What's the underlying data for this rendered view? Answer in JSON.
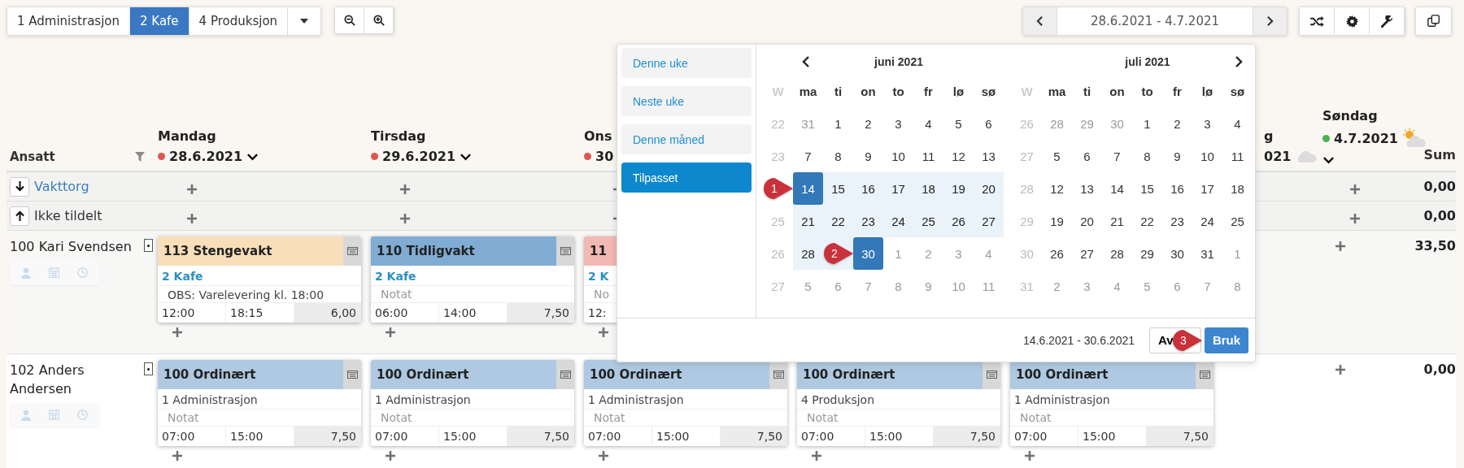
{
  "unit_tabs": [
    {
      "label": "1 Administrasjon",
      "selected": false
    },
    {
      "label": "2 Kafe",
      "selected": true
    },
    {
      "label": "4 Produksjon",
      "selected": false
    }
  ],
  "date_range": "28.6.2021 - 4.7.2021",
  "grid": {
    "employee_header": "Ansatt",
    "sum_header": "Sum",
    "days": [
      {
        "name": "Mandag",
        "date": "28.6.2021",
        "color": "#e05552",
        "chevron": true
      },
      {
        "name": "Tirsdag",
        "date": "29.6.2021",
        "color": "#e05552",
        "chevron": true
      },
      {
        "name": "Ons",
        "date": "30",
        "color": "#e05552",
        "chevron": false
      }
    ],
    "days_right": [
      {
        "name": "g",
        "date": "021",
        "weather": {
          "kind": "cloudy"
        },
        "chevron": false
      },
      {
        "name": "Søndag",
        "date": "4.7.2021",
        "color": "#4cb050",
        "weather": {
          "kind": "partly-sunny"
        },
        "chevron": true
      }
    ],
    "rows": [
      {
        "kind": "pool",
        "label": "Vakttorg",
        "arrow": {
          "kind": "down"
        },
        "link": true,
        "sum": "0,00",
        "cells": [
          {
            "add": true
          },
          {
            "add": true
          },
          {
            "add": true
          },
          null,
          null,
          null,
          {
            "add": true
          }
        ]
      },
      {
        "kind": "pool",
        "label": "Ikke tildelt",
        "arrow": {
          "kind": "up"
        },
        "link": false,
        "sum": "0,00",
        "cells": [
          {
            "add": true
          },
          {
            "add": true
          },
          {
            "add": true
          },
          null,
          null,
          null,
          {
            "add": true
          }
        ]
      },
      {
        "kind": "employee",
        "name": "100 Kari Svendsen",
        "sum": "33,50",
        "cells": [
          {
            "add": true,
            "shift": {
              "title": "113 Stengevakt",
              "color": "#f8dfb9",
              "unit": "2 Kafe",
              "unit_link": true,
              "note": "OBS: Varelevering kl. 18:00",
              "start": "12:00",
              "end": "18:15",
              "hours": "6,00"
            }
          },
          {
            "add": true,
            "shift": {
              "title": "110 Tidligvakt",
              "color": "#80acd3",
              "unit": "2 Kafe",
              "unit_link": true,
              "note_placeholder": "Notat",
              "start": "06:00",
              "end": "14:00",
              "hours": "7,50"
            }
          },
          {
            "add": true,
            "shift": {
              "title": "11",
              "color": "#f2b8b4",
              "unit": "2 K",
              "unit_link": true,
              "note_placeholder": "No",
              "start": "12:"
            }
          },
          null,
          null,
          null,
          {
            "add": true
          }
        ]
      },
      {
        "kind": "employee",
        "name": "102 Anders Andersen",
        "sum": "0,00",
        "cells": [
          {
            "add": true,
            "shift": {
              "title": "100 Ordinært",
              "color": "#afc9e2",
              "unit": "1 Administrasjon",
              "unit_link": false,
              "note_placeholder": "Notat",
              "start": "07:00",
              "end": "15:00",
              "hours": "7,50"
            }
          },
          {
            "add": true,
            "shift": {
              "title": "100 Ordinært",
              "color": "#afc9e2",
              "unit": "1 Administrasjon",
              "unit_link": false,
              "note_placeholder": "Notat",
              "start": "07:00",
              "end": "15:00",
              "hours": "7,50"
            }
          },
          {
            "add": true,
            "shift": {
              "title": "100 Ordinært",
              "color": "#afc9e2",
              "unit": "1 Administrasjon",
              "unit_link": false,
              "note_placeholder": "Notat",
              "start": "07:00",
              "end": "15:00",
              "hours": "7,50"
            }
          },
          {
            "add": true,
            "shift": {
              "title": "100 Ordinært",
              "color": "#afc9e2",
              "unit": "4 Produksjon",
              "unit_link": false,
              "note_placeholder": "Notat",
              "start": "07:00",
              "end": "15:00",
              "hours": "7,50"
            }
          },
          {
            "add": true,
            "shift": {
              "title": "100 Ordinært",
              "color": "#afc9e2",
              "unit": "1 Administrasjon",
              "unit_link": false,
              "note_placeholder": "Notat",
              "start": "07:00",
              "end": "15:00",
              "hours": "7,50"
            }
          },
          null,
          {
            "add": true
          }
        ]
      }
    ]
  },
  "date_picker": {
    "presets": [
      {
        "label": "Denne uke",
        "selected": false
      },
      {
        "label": "Neste uke",
        "selected": false
      },
      {
        "label": "Denne måned",
        "selected": false
      },
      {
        "label": "Tilpasset",
        "selected": true
      }
    ],
    "months": [
      {
        "title": "juni 2021",
        "prev": true,
        "next": false,
        "week_header": "W",
        "weekdays": [
          "ma",
          "ti",
          "on",
          "to",
          "fr",
          "lø",
          "sø"
        ],
        "weeks": [
          {
            "week": "22",
            "days": [
              {
                "day": "31",
                "kind": "outside"
              },
              {
                "day": "1",
                "kind": "normal"
              },
              {
                "day": "2",
                "kind": "normal"
              },
              {
                "day": "3",
                "kind": "normal"
              },
              {
                "day": "4",
                "kind": "normal"
              },
              {
                "day": "5",
                "kind": "normal"
              },
              {
                "day": "6",
                "kind": "normal"
              }
            ]
          },
          {
            "week": "23",
            "days": [
              {
                "day": "7",
                "kind": "normal"
              },
              {
                "day": "8",
                "kind": "normal"
              },
              {
                "day": "9",
                "kind": "normal"
              },
              {
                "day": "10",
                "kind": "normal"
              },
              {
                "day": "11",
                "kind": "normal"
              },
              {
                "day": "12",
                "kind": "normal"
              },
              {
                "day": "13",
                "kind": "normal"
              }
            ]
          },
          {
            "callout": "1",
            "days": [
              {
                "day": "14",
                "kind": "endpoint"
              },
              {
                "day": "15",
                "kind": "range"
              },
              {
                "day": "16",
                "kind": "range"
              },
              {
                "day": "17",
                "kind": "range"
              },
              {
                "day": "18",
                "kind": "range"
              },
              {
                "day": "19",
                "kind": "range"
              },
              {
                "day": "20",
                "kind": "range"
              }
            ]
          },
          {
            "week": "25",
            "days": [
              {
                "day": "21",
                "kind": "range"
              },
              {
                "day": "22",
                "kind": "range"
              },
              {
                "day": "23",
                "kind": "range"
              },
              {
                "day": "24",
                "kind": "range"
              },
              {
                "day": "25",
                "kind": "range"
              },
              {
                "day": "26",
                "kind": "range"
              },
              {
                "day": "27",
                "kind": "range"
              }
            ]
          },
          {
            "week": "26",
            "days": [
              {
                "day": "28",
                "kind": "range"
              },
              {
                "callout": "2",
                "kind": "range"
              },
              {
                "day": "30",
                "kind": "endpoint"
              },
              {
                "day": "1",
                "kind": "outside"
              },
              {
                "day": "2",
                "kind": "outside"
              },
              {
                "day": "3",
                "kind": "outside"
              },
              {
                "day": "4",
                "kind": "outside"
              }
            ]
          },
          {
            "week": "27",
            "days": [
              {
                "day": "5",
                "kind": "outside"
              },
              {
                "day": "6",
                "kind": "outside"
              },
              {
                "day": "7",
                "kind": "outside"
              },
              {
                "day": "8",
                "kind": "outside"
              },
              {
                "day": "9",
                "kind": "outside"
              },
              {
                "day": "10",
                "kind": "outside"
              },
              {
                "day": "11",
                "kind": "outside"
              }
            ]
          }
        ]
      },
      {
        "title": "juli 2021",
        "prev": false,
        "next": true,
        "week_header": "W",
        "weekdays": [
          "ma",
          "ti",
          "on",
          "to",
          "fr",
          "lø",
          "sø"
        ],
        "weeks": [
          {
            "week": "26",
            "days": [
              {
                "day": "28",
                "kind": "outside"
              },
              {
                "day": "29",
                "kind": "outside"
              },
              {
                "day": "30",
                "kind": "outside"
              },
              {
                "day": "1",
                "kind": "normal"
              },
              {
                "day": "2",
                "kind": "normal"
              },
              {
                "day": "3",
                "kind": "normal"
              },
              {
                "day": "4",
                "kind": "normal"
              }
            ]
          },
          {
            "week": "27",
            "days": [
              {
                "day": "5",
                "kind": "normal"
              },
              {
                "day": "6",
                "kind": "normal"
              },
              {
                "day": "7",
                "kind": "normal"
              },
              {
                "day": "8",
                "kind": "normal"
              },
              {
                "day": "9",
                "kind": "normal"
              },
              {
                "day": "10",
                "kind": "normal"
              },
              {
                "day": "11",
                "kind": "normal"
              }
            ]
          },
          {
            "week": "28",
            "days": [
              {
                "day": "12",
                "kind": "normal"
              },
              {
                "day": "13",
                "kind": "normal"
              },
              {
                "day": "14",
                "kind": "normal"
              },
              {
                "day": "15",
                "kind": "normal"
              },
              {
                "day": "16",
                "kind": "normal"
              },
              {
                "day": "17",
                "kind": "normal"
              },
              {
                "day": "18",
                "kind": "normal"
              }
            ]
          },
          {
            "week": "29",
            "days": [
              {
                "day": "19",
                "kind": "normal"
              },
              {
                "day": "20",
                "kind": "normal"
              },
              {
                "day": "21",
                "kind": "normal"
              },
              {
                "day": "22",
                "kind": "normal"
              },
              {
                "day": "23",
                "kind": "normal"
              },
              {
                "day": "24",
                "kind": "normal"
              },
              {
                "day": "25",
                "kind": "normal"
              }
            ]
          },
          {
            "week": "30",
            "days": [
              {
                "day": "26",
                "kind": "normal"
              },
              {
                "day": "27",
                "kind": "normal"
              },
              {
                "day": "28",
                "kind": "normal"
              },
              {
                "day": "29",
                "kind": "normal"
              },
              {
                "day": "30",
                "kind": "normal"
              },
              {
                "day": "31",
                "kind": "normal"
              },
              {
                "day": "1",
                "kind": "outside"
              }
            ]
          },
          {
            "week": "31",
            "days": [
              {
                "day": "2",
                "kind": "outside"
              },
              {
                "day": "3",
                "kind": "outside"
              },
              {
                "day": "4",
                "kind": "outside"
              },
              {
                "day": "5",
                "kind": "outside"
              },
              {
                "day": "6",
                "kind": "outside"
              },
              {
                "day": "7",
                "kind": "outside"
              },
              {
                "day": "8",
                "kind": "outside"
              }
            ]
          }
        ]
      }
    ],
    "range_text": "14.6.2021 - 30.6.2021",
    "cancel": "Av",
    "apply": "Bruk",
    "apply_callout": "3"
  }
}
